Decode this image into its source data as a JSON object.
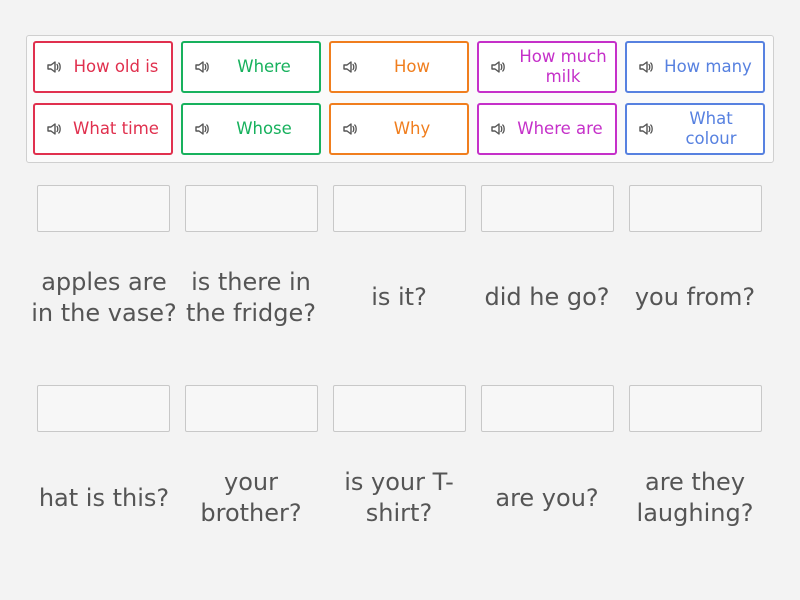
{
  "tiles": [
    {
      "label": "How old is",
      "color": "#e0304e"
    },
    {
      "label": "Where",
      "color": "#17b15d"
    },
    {
      "label": "How",
      "color": "#f07e1e"
    },
    {
      "label": "How much milk",
      "color": "#c530c9"
    },
    {
      "label": "How many",
      "color": "#5781e0"
    },
    {
      "label": "What time",
      "color": "#e0304e"
    },
    {
      "label": "Whose",
      "color": "#17b15d"
    },
    {
      "label": "Why",
      "color": "#f07e1e"
    },
    {
      "label": "Where are",
      "color": "#c530c9"
    },
    {
      "label": "What colour",
      "color": "#5781e0"
    }
  ],
  "speaker_icon": "speaker-icon",
  "phrases_row1": [
    "apples are in the vase?",
    "is there in the fridge?",
    "is it?",
    "did he go?",
    "you from?"
  ],
  "phrases_row2": [
    "hat is this?",
    "your brother?",
    "is your T-shirt?",
    "are you?",
    "are they laughing?"
  ]
}
